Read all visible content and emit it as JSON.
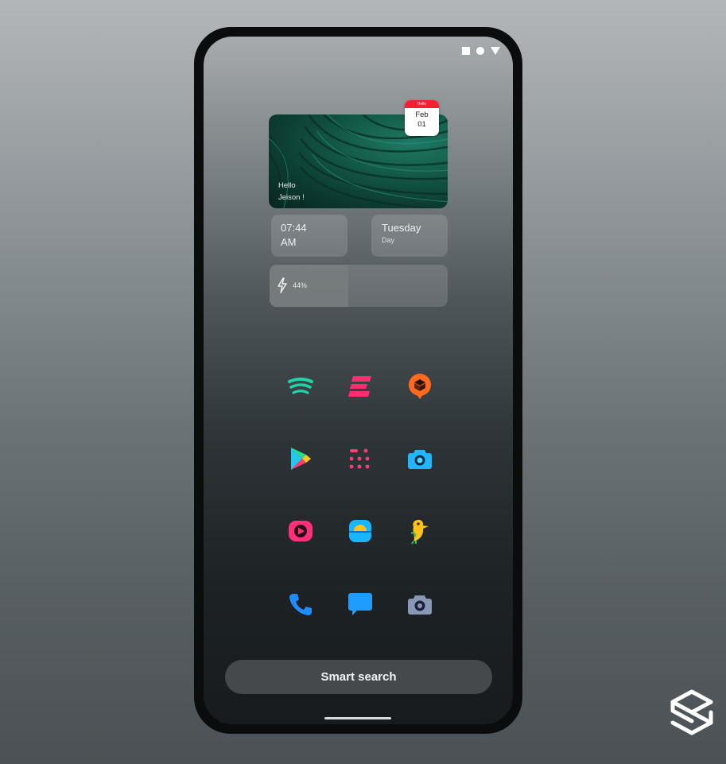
{
  "status_icons": [
    "square-icon",
    "circle-icon",
    "triangle-icon"
  ],
  "photo_widget": {
    "greeting_line1": "Hello",
    "greeting_line2": "Jeison !"
  },
  "calendar_badge": {
    "header": "Hello",
    "month": "Feb",
    "day": "01",
    "header_color": "#f4202f"
  },
  "time_widget": {
    "time": "07:44",
    "meridiem": "AM"
  },
  "day_widget": {
    "weekday": "Tuesday",
    "label": "Day"
  },
  "battery_widget": {
    "percent_label": "44%",
    "level": 0.44
  },
  "apps": [
    {
      "name": "spotify-icon",
      "color": "#1ed4a8"
    },
    {
      "name": "e-letter-icon",
      "color": "#ff2d6f"
    },
    {
      "name": "map-pin-icon",
      "color": "#ff6a1f"
    },
    {
      "name": "play-store-icon",
      "color": "#26c6f0"
    },
    {
      "name": "dots-grid-icon",
      "color": "#ff3c74"
    },
    {
      "name": "camera-icon",
      "color": "#1fb7ff"
    },
    {
      "name": "youtube-icon",
      "color": "#ff2f7a"
    },
    {
      "name": "weather-icon",
      "color": "#18b6ff"
    },
    {
      "name": "bird-icon",
      "color": "#ffc21a"
    },
    {
      "name": "phone-icon",
      "color": "#1f8dff"
    },
    {
      "name": "message-icon",
      "color": "#1f9dff"
    },
    {
      "name": "grey-camera-icon",
      "color": "#8a98b8"
    }
  ],
  "search": {
    "label": "Smart search"
  },
  "brand_logo": "stacked-s-logo-icon"
}
